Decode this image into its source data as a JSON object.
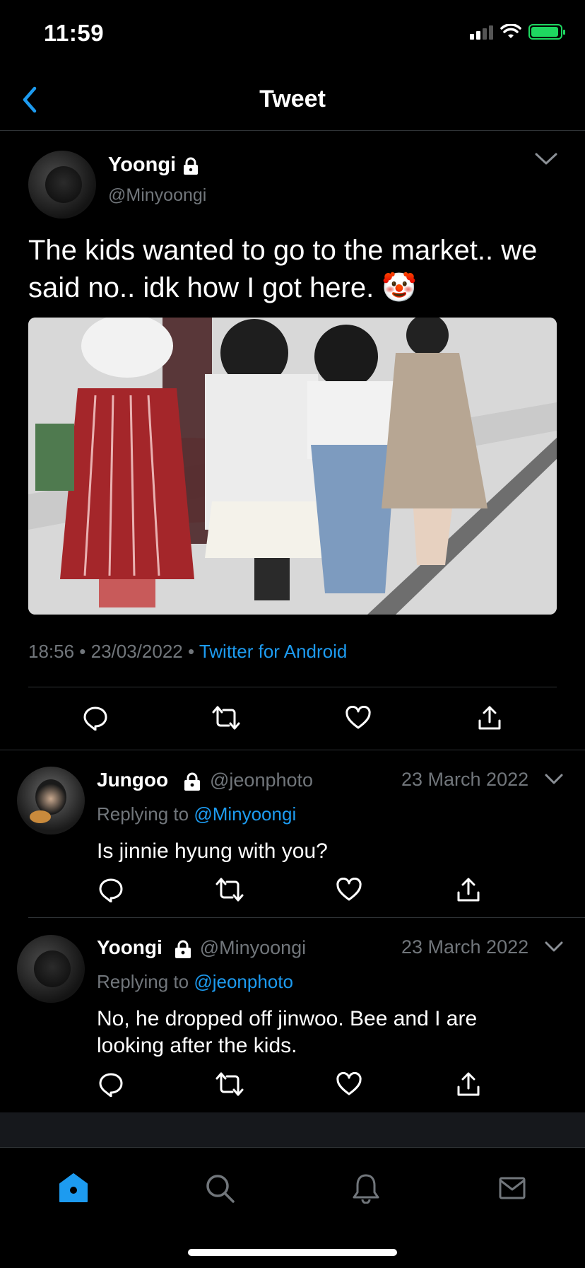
{
  "status_bar": {
    "time": "11:59"
  },
  "header": {
    "title": "Tweet"
  },
  "main_tweet": {
    "author_name": "Yoongi",
    "author_handle": "@Minyoongi",
    "text": "The kids wanted to go to the market.. we said no.. idk how I got here. 🤡",
    "timestamp": "18:56 • 23/03/2022 • ",
    "source": "Twitter for Android"
  },
  "replies": [
    {
      "author_name": "Jungoo",
      "author_handle": "@jeonphoto",
      "date": "23 March 2022",
      "replying_label": "Replying to ",
      "replying_to": "@Minyoongi",
      "text": "Is jinnie hyung with you?"
    },
    {
      "author_name": "Yoongi",
      "author_handle": "@Minyoongi",
      "date": "23 March 2022",
      "replying_label": "Replying to ",
      "replying_to": "@jeonphoto",
      "text": "No, he dropped off jinwoo. Bee and I are looking after the kids."
    }
  ],
  "icons": [
    "back-icon",
    "lock-icon",
    "chevron-down-icon",
    "reply-icon",
    "retweet-icon",
    "like-icon",
    "share-icon",
    "home-icon",
    "search-icon",
    "notifications-icon",
    "messages-icon"
  ],
  "colors": {
    "accent": "#1d9bf0",
    "background": "#000000",
    "secondary_text": "#71767b",
    "divider": "#2f3336",
    "battery": "#1ed760"
  }
}
